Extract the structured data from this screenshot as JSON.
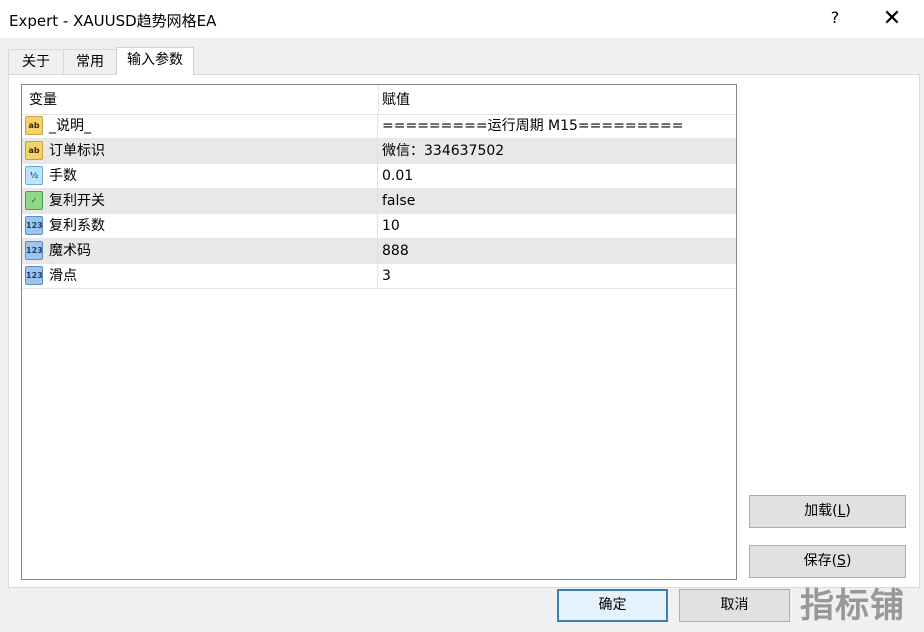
{
  "window": {
    "title": "Expert - XAUUSD趋势网格EA",
    "help_label": "?",
    "close_label": "✕"
  },
  "tabs": [
    {
      "label": "关于"
    },
    {
      "label": "常用"
    },
    {
      "label": "输入参数",
      "active": true
    }
  ],
  "grid": {
    "columns": [
      "变量",
      "赋值"
    ],
    "rows": [
      {
        "icon": "string-icon",
        "icon_text": "ab",
        "name": "_说明_",
        "value": "=========运行周期 M15========="
      },
      {
        "icon": "string-icon",
        "icon_text": "ab",
        "name": "订单标识",
        "value": "微信：334637502"
      },
      {
        "icon": "double-icon",
        "icon_text": "½",
        "name": "手数",
        "value": "0.01"
      },
      {
        "icon": "bool-icon",
        "icon_text": "✓",
        "name": "复利开关",
        "value": "false"
      },
      {
        "icon": "integer-icon",
        "icon_text": "123",
        "name": "复利系数",
        "value": "10"
      },
      {
        "icon": "integer-icon",
        "icon_text": "123",
        "name": "魔术码",
        "value": "888"
      },
      {
        "icon": "integer-icon",
        "icon_text": "123",
        "name": "滑点",
        "value": "3"
      }
    ]
  },
  "side_buttons": {
    "load": {
      "text": "加载(",
      "hotkey": "L",
      "suffix": ")"
    },
    "save": {
      "text": "保存(",
      "hotkey": "S",
      "suffix": ")"
    }
  },
  "footer": {
    "ok": "确定",
    "cancel": "取消"
  },
  "watermark": "指标铺",
  "colors": {
    "default_button_border": "#3c7fb1",
    "alt_row": "#e8e8e8"
  }
}
